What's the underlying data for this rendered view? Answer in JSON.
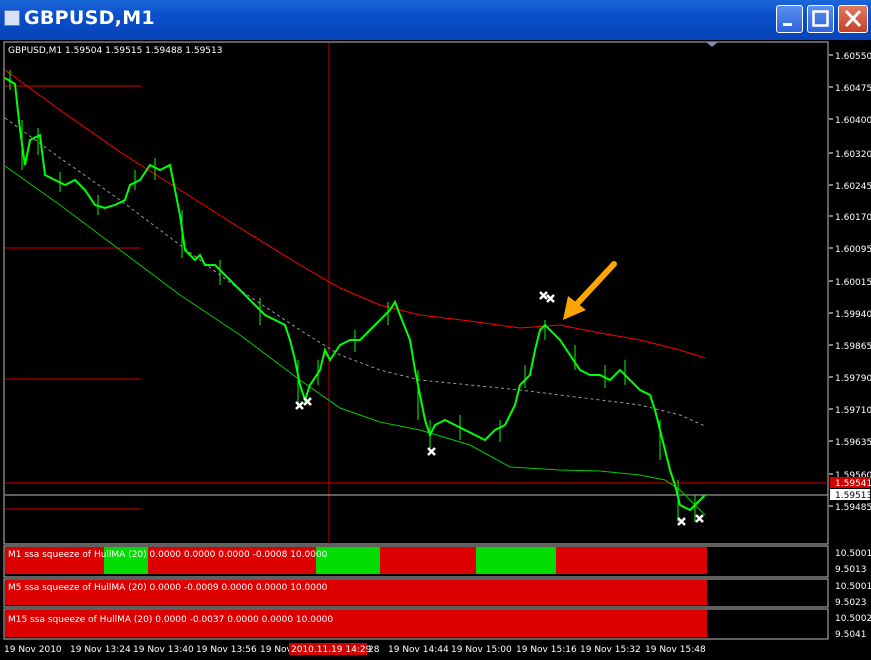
{
  "window": {
    "title": "GBPUSD,M1",
    "buttons": [
      "minimize",
      "maximize",
      "close"
    ]
  },
  "main_chart": {
    "info": "GBPUSD,M1 1.59504 1.59515 1.59488 1.59513",
    "price_labels": [
      "1.60550",
      "1.60475",
      "1.60400",
      "1.60320",
      "1.60245",
      "1.60170",
      "1.60095",
      "1.60015",
      "1.59940",
      "1.59865",
      "1.59790",
      "1.59710",
      "1.59635",
      "1.59560",
      "1.59485"
    ],
    "current_price": "1.59513",
    "red_price": "1.59541"
  },
  "indicator_panels": [
    {
      "text": "M1 ssa squeeze of HullMA (20) 0.0000 0.0000 0.0000 -0.0008 10.0000",
      "scale_top": "10.5001",
      "scale_bottom": "9.5013"
    },
    {
      "text": "M5 ssa squeeze of HullMA (20) 0.0000 -0.0009 0.0000 0.0000 10.0000",
      "scale_top": "10.5001",
      "scale_bottom": "9.5023"
    },
    {
      "text": "M15 ssa squeeze of HullMA (20) 0.0000 -0.0037 0.0000 0.0000 10.0000",
      "scale_top": "10.5002",
      "scale_bottom": "9.5041"
    }
  ],
  "time_axis": {
    "labels": [
      "19 Nov 2010",
      "19 Nov 13:24",
      "19 Nov 13:40",
      "19 Nov 13:56",
      "19 Nov",
      "28",
      "19 Nov 14:44",
      "19 Nov 15:00",
      "19 Nov 15:16",
      "19 Nov 15:32",
      "19 Nov 15:48"
    ],
    "highlight": "2010.11.19 14:29"
  },
  "colors": {
    "candle": "#00ff00",
    "upper_band": "#ff0000",
    "lower_band": "#00cc00",
    "midline": "#9a9a9a",
    "arrow": "#ffa500",
    "squeeze_on": "#ee0000",
    "squeeze_off": "#00ee00"
  }
}
